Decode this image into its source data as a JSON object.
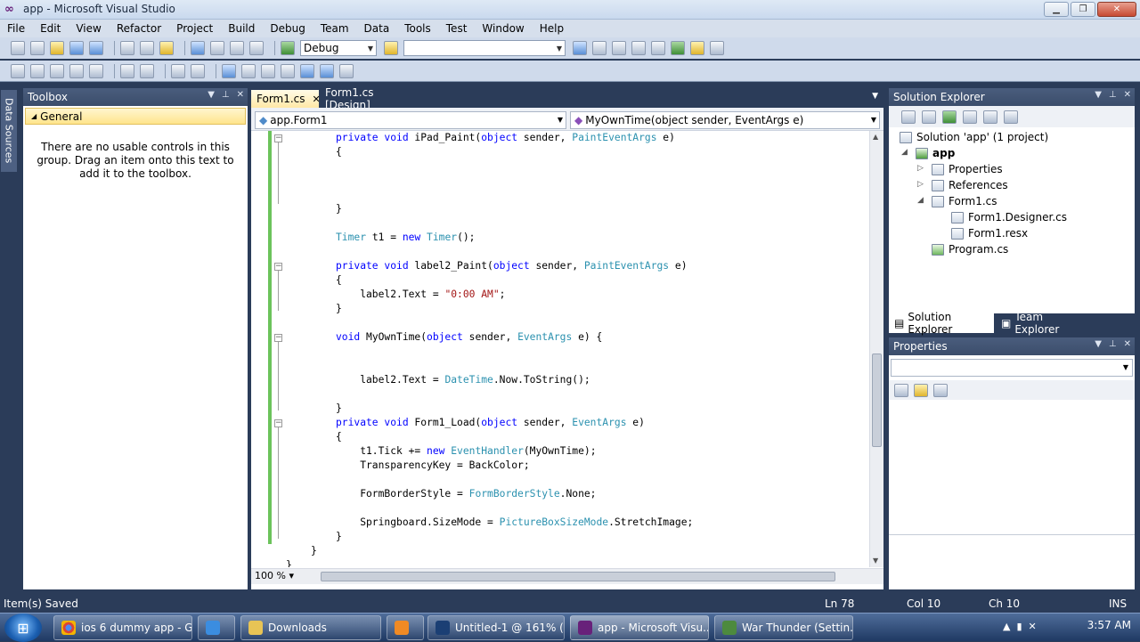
{
  "window": {
    "title": "app - Microsoft Visual Studio"
  },
  "menu": [
    "File",
    "Edit",
    "View",
    "Refactor",
    "Project",
    "Build",
    "Debug",
    "Team",
    "Data",
    "Tools",
    "Test",
    "Window",
    "Help"
  ],
  "toolbar": {
    "config": "Debug",
    "platform": ""
  },
  "left_strip": {
    "label": "Data Sources"
  },
  "toolbox": {
    "title": "Toolbox",
    "group": "General",
    "message": "There are no usable controls in this group. Drag an item onto this text to add it to the toolbox."
  },
  "editor": {
    "tabs": [
      {
        "label": "Form1.cs",
        "active": true
      },
      {
        "label": "Form1.cs [Design]",
        "active": false
      }
    ],
    "nav_left": "app.Form1",
    "nav_right": "MyOwnTime(object sender, EventArgs e)",
    "zoom": "100 %",
    "lines": [
      [
        [
          "kw",
          "private void "
        ],
        [
          "",
          "iPad_Paint("
        ],
        [
          "kw",
          "object"
        ],
        [
          "",
          " sender, "
        ],
        [
          "ty",
          "PaintEventArgs"
        ],
        [
          "",
          " e)"
        ]
      ],
      [
        [
          "",
          "{"
        ]
      ],
      [],
      [],
      [],
      [
        [
          "",
          "}"
        ]
      ],
      [],
      [
        [
          "ty",
          "Timer"
        ],
        [
          "",
          " t1 = "
        ],
        [
          "kw",
          "new "
        ],
        [
          "ty",
          "Timer"
        ],
        [
          "",
          "();"
        ]
      ],
      [],
      [
        [
          "kw",
          "private void "
        ],
        [
          "",
          "label2_Paint("
        ],
        [
          "kw",
          "object"
        ],
        [
          "",
          " sender, "
        ],
        [
          "ty",
          "PaintEventArgs"
        ],
        [
          "",
          " e)"
        ]
      ],
      [
        [
          "",
          "{"
        ]
      ],
      [
        [
          "",
          "    label2.Text = "
        ],
        [
          "st",
          "\"0:00 AM\""
        ],
        [
          "",
          ";"
        ]
      ],
      [
        [
          "",
          "}"
        ]
      ],
      [],
      [
        [
          "kw",
          "void "
        ],
        [
          "",
          "MyOwnTime("
        ],
        [
          "kw",
          "object"
        ],
        [
          "",
          " sender, "
        ],
        [
          "ty",
          "EventArgs"
        ],
        [
          "",
          " e) {"
        ]
      ],
      [],
      [],
      [
        [
          "",
          "    label2.Text = "
        ],
        [
          "ty",
          "DateTime"
        ],
        [
          "",
          ".Now.ToString();"
        ]
      ],
      [],
      [
        [
          "",
          "}"
        ]
      ],
      [
        [
          "kw",
          "private void "
        ],
        [
          "",
          "Form1_Load("
        ],
        [
          "kw",
          "object"
        ],
        [
          "",
          " sender, "
        ],
        [
          "ty",
          "EventArgs"
        ],
        [
          "",
          " e)"
        ]
      ],
      [
        [
          "",
          "{"
        ]
      ],
      [
        [
          "",
          "    t1.Tick += "
        ],
        [
          "kw",
          "new "
        ],
        [
          "ty",
          "EventHandler"
        ],
        [
          "",
          "(MyOwnTime);"
        ]
      ],
      [
        [
          "",
          "    TransparencyKey = BackColor;"
        ]
      ],
      [],
      [
        [
          "",
          "    FormBorderStyle = "
        ],
        [
          "ty",
          "FormBorderStyle"
        ],
        [
          "",
          ".None;"
        ]
      ],
      [],
      [
        [
          "",
          "    Springboard.SizeMode = "
        ],
        [
          "ty",
          "PictureBoxSizeMode"
        ],
        [
          "",
          ".StretchImage;"
        ]
      ],
      [
        [
          "",
          "}"
        ]
      ],
      [
        [
          "",
          "}"
        ]
      ],
      [
        [
          "",
          "}"
        ]
      ]
    ]
  },
  "solution_explorer": {
    "title": "Solution Explorer",
    "solution": "Solution 'app' (1 project)",
    "project": "app",
    "items": [
      "Properties",
      "References",
      "Form1.cs",
      "Form1.Designer.cs",
      "Form1.resx",
      "Program.cs"
    ],
    "tabs": [
      "Solution Explorer",
      "Team Explorer"
    ]
  },
  "properties": {
    "title": "Properties"
  },
  "status": {
    "message": "Item(s) Saved",
    "ln": "Ln 78",
    "col": "Col 10",
    "ch": "Ch 10",
    "mode": "INS"
  },
  "taskbar": {
    "items": [
      "ios 6 dummy app - G...",
      "",
      "Downloads",
      "",
      "Untitled-1 @ 161% (L...",
      "app - Microsoft Visu...",
      "War Thunder (Settin..."
    ],
    "time": "3:57 AM"
  },
  "colors": {
    "keyword": "#0000ff",
    "type": "#2b91af",
    "string": "#a31515",
    "changebar": "#6cc35b",
    "frame": "#2b3c59"
  }
}
